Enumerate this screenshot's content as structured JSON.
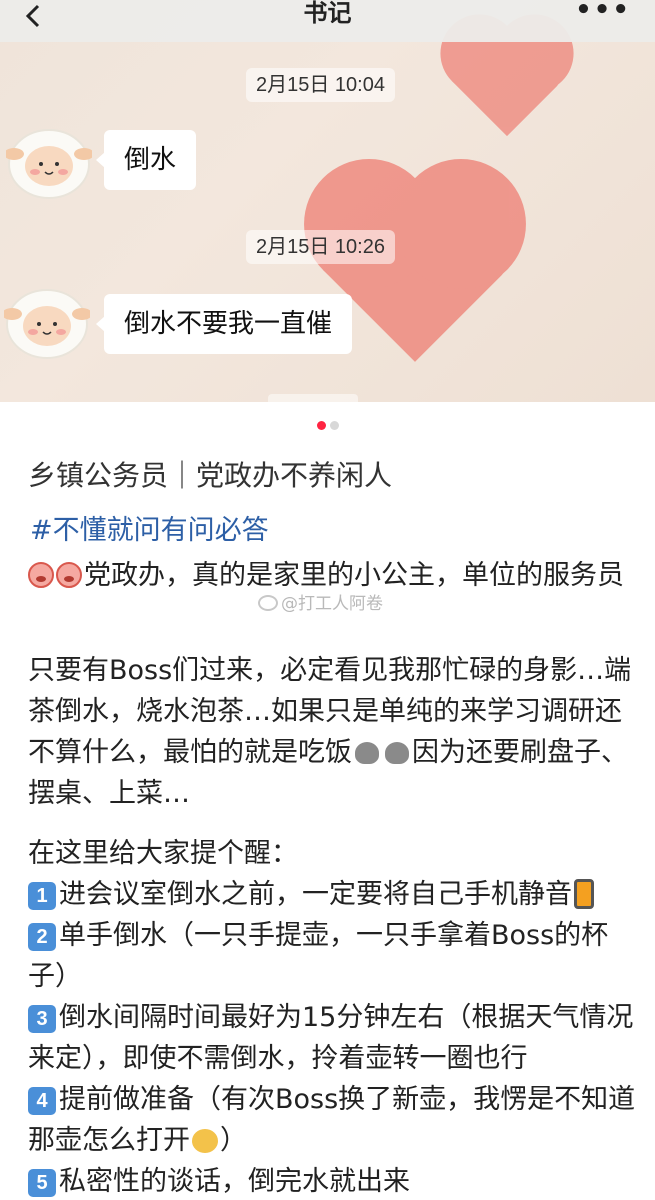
{
  "nav": {
    "title": "书记",
    "more_label": "•••"
  },
  "chat": {
    "messages": [
      {
        "timestamp": "2月15日 10:04",
        "text": "倒水"
      },
      {
        "timestamp": "2月15日 10:26",
        "text": "倒水不要我一直催"
      }
    ]
  },
  "carousel": {
    "current_page": 1,
    "total_pages": 2
  },
  "post": {
    "title": "乡镇公务员｜党政办不养闲人",
    "tag": "#不懂就问有问必答",
    "intro": "党政办，真的是家里的小公主，单位的服务员",
    "watermark": "@打工人阿卷",
    "paragraph2": "只要有Boss们过来，必定看见我那忙碌的身影…端茶倒水，烧水泡茶…如果只是单纯的来学习调研还不算什么，最怕的就是吃饭",
    "paragraph2_end": "因为还要刷盘子、摆桌、上菜…",
    "tips_heading": "在这里给大家提个醒：",
    "tips": [
      {
        "num": "1",
        "text": "进会议室倒水之前，一定要将自己手机静音"
      },
      {
        "num": "2",
        "text": "单手倒水（一只手提壶，一只手拿着Boss的杯子）"
      },
      {
        "num": "3",
        "text": "倒水间隔时间最好为15分钟左右（根据天气情况来定），即使不需倒水，拎着壶转一圈也行"
      },
      {
        "num": "4",
        "text": "提前做准备（有次Boss换了新壶，我愣是不知道那壶怎么打开",
        "suffix": "）"
      },
      {
        "num": "5",
        "text": "私密性的谈话，倒完水就出来"
      }
    ]
  },
  "colors": {
    "tag_blue": "#2d5fa6",
    "active_dot": "#ff2442",
    "heart": "#ee7e73"
  }
}
